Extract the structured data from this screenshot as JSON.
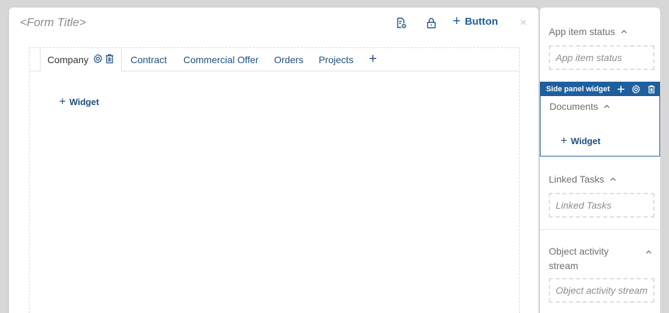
{
  "form": {
    "title": "<Form Title>",
    "header_icons": [
      "document-settings-icon",
      "lock-icon"
    ],
    "button_label": "Button",
    "close_label": "×"
  },
  "tabs": {
    "items": [
      {
        "label": "Company",
        "active": true
      },
      {
        "label": "Contract"
      },
      {
        "label": "Commercial Offer"
      },
      {
        "label": "Orders"
      },
      {
        "label": "Projects"
      }
    ],
    "add_label": "+"
  },
  "main": {
    "widget_label": "Widget"
  },
  "side_panel": {
    "app_item_status": {
      "title": "App item status",
      "placeholder": "App item status"
    },
    "selected_widget": {
      "toolbar_label": "Side panel widget",
      "title": "Documents",
      "widget_label": "Widget"
    },
    "linked_tasks": {
      "title": "Linked Tasks",
      "placeholder": "Linked Tasks"
    },
    "activity_stream": {
      "title_line1": "Object activity",
      "title_line2": "stream",
      "placeholder": "Object activity stream"
    }
  },
  "colors": {
    "accent": "#1f5f9e",
    "link": "#1f4f7e",
    "muted_text": "#8a8a8a",
    "background": "#d7d7d7"
  }
}
